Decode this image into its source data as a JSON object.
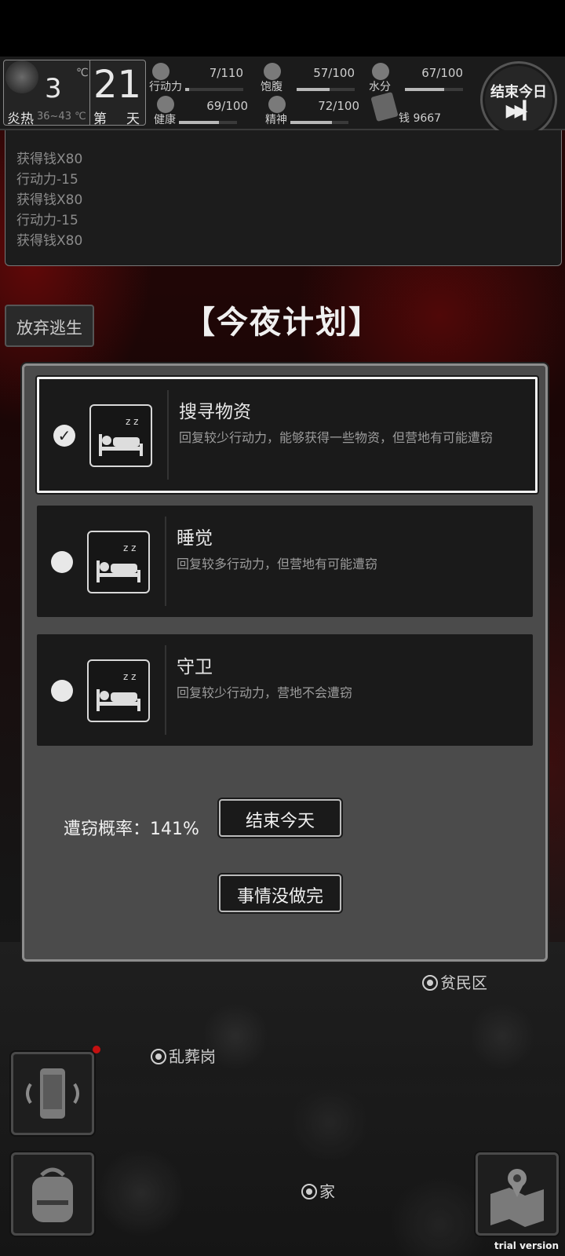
{
  "weather": {
    "temperature": "3",
    "unit": "℃",
    "label": "炎热",
    "range": "36~43 ℃"
  },
  "day": {
    "number": "21",
    "prefix": "第",
    "suffix": "天"
  },
  "stats": [
    {
      "label": "行动力",
      "value": "7/110",
      "fraction": 0.064,
      "icon": "footprints-icon"
    },
    {
      "label": "饱腹",
      "value": "57/100",
      "fraction": 0.57,
      "icon": "stomach-icon"
    },
    {
      "label": "水分",
      "value": "67/100",
      "fraction": 0.67,
      "icon": "water-drop-icon"
    },
    {
      "label": "健康",
      "value": "69/100",
      "fraction": 0.69,
      "icon": "medkit-icon"
    },
    {
      "label": "精神",
      "value": "72/100",
      "fraction": 0.72,
      "icon": "brain-icon"
    }
  ],
  "money": {
    "label": "钱 9667",
    "icon": "cash-icon"
  },
  "end_day_button": {
    "label": "结束今日",
    "icon": "fast-forward-icon"
  },
  "log": {
    "lines": [
      "获得钱X80",
      "行动力-15",
      "获得钱X80",
      "行动力-15",
      "获得钱X80"
    ]
  },
  "abandon_button": "放弃逃生",
  "plan_title": "【今夜计划】",
  "options": [
    {
      "title": "搜寻物资",
      "description": "回复较少行动力，能够获得一些物资，但营地有可能遭窃",
      "selected": true,
      "icon": "sleeping-bed-icon"
    },
    {
      "title": "睡觉",
      "description": "回复较多行动力，但营地有可能遭窃",
      "selected": false,
      "icon": "sleeping-bed-icon"
    },
    {
      "title": "守卫",
      "description": "回复较少行动力，营地不会遭窃",
      "selected": false,
      "icon": "sleeping-bed-icon"
    }
  ],
  "theft_rate": "遭窃概率：141%",
  "end_today_button": "结束今天",
  "unfinished_button": "事情没做完",
  "map_locations": {
    "slum": "贫民区",
    "graveyard": "乱葬岗",
    "home": "家"
  },
  "trial_watermark": "trial version"
}
